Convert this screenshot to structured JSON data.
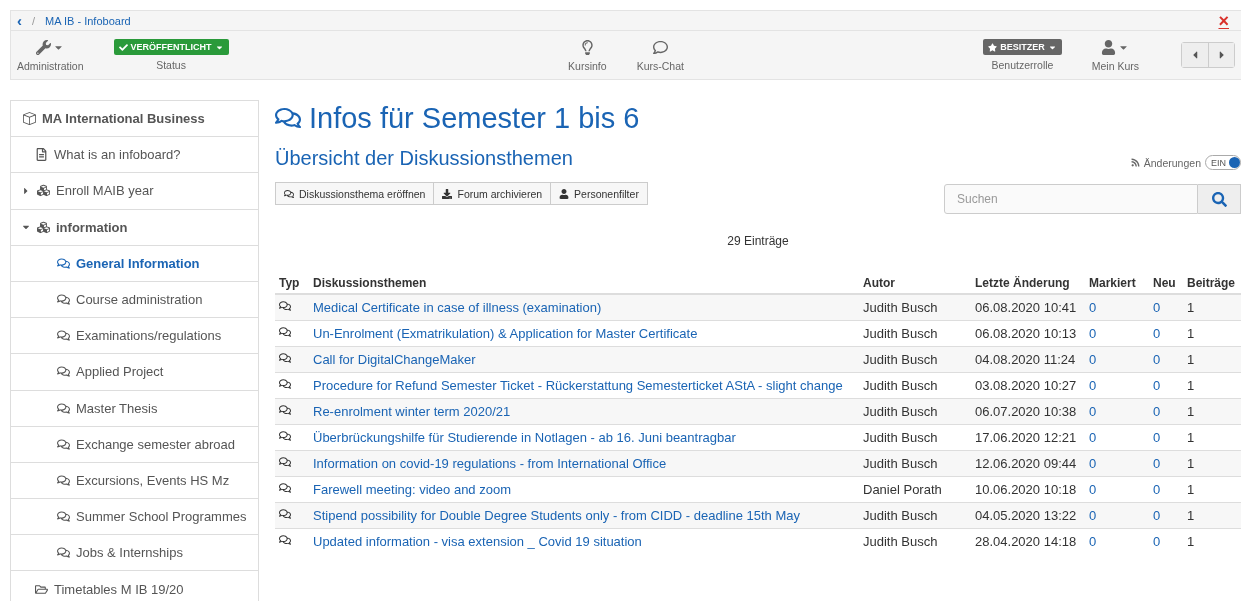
{
  "breadcrumb": {
    "back": "‹",
    "separator": "/",
    "items": [
      "MA IB - Infoboard"
    ],
    "close": "×"
  },
  "toolbar": {
    "left": [
      {
        "kind": "admin",
        "label": "Administration"
      },
      {
        "kind": "status",
        "badge": "VERÖFFENTLICHT",
        "label": "Status"
      }
    ],
    "center": [
      {
        "kind": "bulb",
        "label": "Kursinfo"
      },
      {
        "kind": "chat",
        "label": "Kurs-Chat"
      }
    ],
    "right": [
      {
        "kind": "role",
        "badge": "BESITZER",
        "label": "Benutzerrolle"
      },
      {
        "kind": "user",
        "label": "Mein Kurs"
      }
    ]
  },
  "sidebar": {
    "items": [
      {
        "kind": "course",
        "label": "MA International Business",
        "selected": false
      },
      {
        "kind": "page",
        "label": "What is an infoboard?",
        "selected": false
      },
      {
        "kind": "structure",
        "label": "Enroll MAIB year",
        "selected": false,
        "expanded": false
      },
      {
        "kind": "structure",
        "label": "information",
        "selected": false,
        "expanded": true,
        "children": [
          {
            "kind": "forum",
            "label": "General Information",
            "selected": true
          },
          {
            "kind": "forum",
            "label": "Course administration",
            "selected": false
          },
          {
            "kind": "forum",
            "label": "Examinations/regulations",
            "selected": false
          },
          {
            "kind": "forum",
            "label": "Applied Project",
            "selected": false
          },
          {
            "kind": "forum",
            "label": "Master Thesis",
            "selected": false
          },
          {
            "kind": "forum",
            "label": "Exchange semester abroad",
            "selected": false
          },
          {
            "kind": "forum",
            "label": "Excursions, Events HS Mz",
            "selected": false
          },
          {
            "kind": "forum",
            "label": "Summer School Programmes",
            "selected": false
          },
          {
            "kind": "forum",
            "label": "Jobs & Internships",
            "selected": false
          }
        ]
      },
      {
        "kind": "folder",
        "label": "Timetables M IB 19/20",
        "selected": false
      }
    ]
  },
  "title": "Infos für Semester 1 bis 6",
  "subtitle": "Übersicht der Diskussionsthemen",
  "subscription": {
    "label": "Änderungen",
    "toggle": "EIN",
    "on": true
  },
  "actions": [
    {
      "kind": "chat",
      "label": "Diskussionsthema eröffnen"
    },
    {
      "kind": "download",
      "label": "Forum archivieren"
    },
    {
      "kind": "user",
      "label": "Personenfilter"
    }
  ],
  "search": {
    "placeholder": "Suchen"
  },
  "count": "29 Einträge",
  "table": {
    "columns": [
      "Typ",
      "Diskussionsthemen",
      "Autor",
      "Letzte Änderung",
      "Markiert",
      "Neu",
      "Beiträge"
    ],
    "rows": [
      {
        "title": "Medical Certificate in case of illness (examination)",
        "author": "Judith Busch",
        "date": "06.08.2020 10:41",
        "marked": "0",
        "new": "0",
        "posts": "1"
      },
      {
        "title": "Un-Enrolment (Exmatrikulation) & Application for Master Certificate",
        "author": "Judith Busch",
        "date": "06.08.2020 10:13",
        "marked": "0",
        "new": "0",
        "posts": "1"
      },
      {
        "title": "Call for DigitalChangeMaker",
        "author": "Judith Busch",
        "date": "04.08.2020 11:24",
        "marked": "0",
        "new": "0",
        "posts": "1"
      },
      {
        "title": "Procedure for Refund Semester Ticket - Rückerstattung Semesterticket AStA - slight change",
        "author": "Judith Busch",
        "date": "03.08.2020 10:27",
        "marked": "0",
        "new": "0",
        "posts": "1"
      },
      {
        "title": "Re-enrolment winter term 2020/21",
        "author": "Judith Busch",
        "date": "06.07.2020 10:38",
        "marked": "0",
        "new": "0",
        "posts": "1"
      },
      {
        "title": "Überbrückungshilfe für Studierende in Notlagen - ab 16. Juni beantragbar",
        "author": "Judith Busch",
        "date": "17.06.2020 12:21",
        "marked": "0",
        "new": "0",
        "posts": "1"
      },
      {
        "title": "Information on covid-19 regulations - from International Office",
        "author": "Judith Busch",
        "date": "12.06.2020 09:44",
        "marked": "0",
        "new": "0",
        "posts": "1"
      },
      {
        "title": "Farewell meeting: video and zoom",
        "author": "Daniel Porath",
        "date": "10.06.2020 10:18",
        "marked": "0",
        "new": "0",
        "posts": "1"
      },
      {
        "title": "Stipend possibility for Double Degree Students only - from CIDD - deadline 15th May",
        "author": "Judith Busch",
        "date": "04.05.2020 13:22",
        "marked": "0",
        "new": "0",
        "posts": "1"
      },
      {
        "title": "Updated information - visa extension _ Covid 19 situation",
        "author": "Judith Busch",
        "date": "28.04.2020 14:18",
        "marked": "0",
        "new": "0",
        "posts": "1"
      }
    ]
  }
}
